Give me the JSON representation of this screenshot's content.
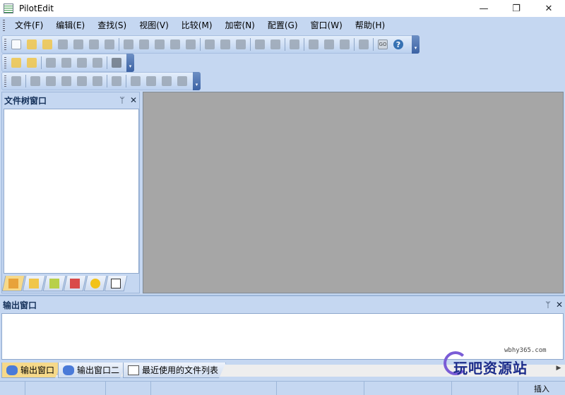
{
  "window": {
    "title": "PilotEdit",
    "minimize": "—",
    "maximize": "❐",
    "close": "✕"
  },
  "menu": [
    "文件(F)",
    "编辑(E)",
    "查找(S)",
    "视图(V)",
    "比较(M)",
    "加密(N)",
    "配置(G)",
    "窗口(W)",
    "帮助(H)"
  ],
  "toolbar": {
    "help_glyph": "?",
    "go_label": "GO",
    "overflow": "▾"
  },
  "file_tree": {
    "title": "文件树窗口",
    "pin": "ᛘ",
    "close": "✕"
  },
  "output": {
    "title": "输出窗口",
    "pin": "ᛘ",
    "close": "✕",
    "scroll_left": "◀",
    "scroll_right": "▶",
    "tabs": [
      "输出窗口",
      "输出窗口二",
      "最近使用的文件列表"
    ]
  },
  "watermark": {
    "url": "wbhy365.com",
    "text": "玩吧资源站"
  },
  "status": {
    "mode": "插入"
  },
  "colors": {
    "chrome": "#c5d7f1",
    "workspace": "#a6a6a6",
    "active_tab": "#f6d98a"
  }
}
